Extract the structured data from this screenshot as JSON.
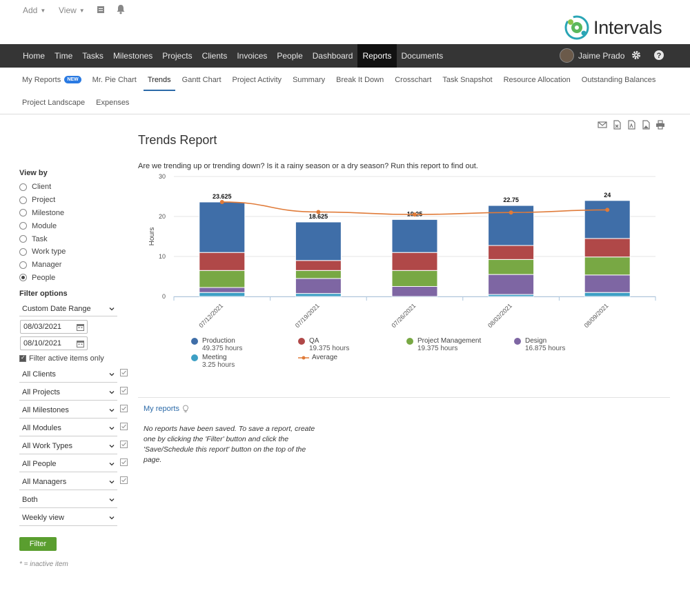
{
  "topbar": {
    "add_label": "Add",
    "view_label": "View",
    "logo_text": "Intervals"
  },
  "nav": {
    "items": [
      {
        "label": "Home"
      },
      {
        "label": "Time"
      },
      {
        "label": "Tasks"
      },
      {
        "label": "Milestones"
      },
      {
        "label": "Projects"
      },
      {
        "label": "Clients"
      },
      {
        "label": "Invoices"
      },
      {
        "label": "People"
      },
      {
        "label": "Dashboard"
      },
      {
        "label": "Reports",
        "active": true
      },
      {
        "label": "Documents"
      }
    ],
    "user_name": "Jaime Prado"
  },
  "subnav": {
    "row1": [
      {
        "label": "My Reports",
        "badge": "NEW"
      },
      {
        "label": "Mr. Pie Chart"
      },
      {
        "label": "Trends",
        "active": true
      },
      {
        "label": "Gantt Chart"
      },
      {
        "label": "Project Activity"
      },
      {
        "label": "Summary"
      },
      {
        "label": "Break It Down"
      },
      {
        "label": "Crosschart"
      },
      {
        "label": "Task Snapshot"
      },
      {
        "label": "Resource Allocation"
      },
      {
        "label": "Outstanding Balances"
      }
    ],
    "row2": [
      {
        "label": "Project Landscape"
      },
      {
        "label": "Expenses"
      }
    ]
  },
  "sidebar": {
    "view_by_title": "View by",
    "view_by": [
      {
        "label": "Client"
      },
      {
        "label": "Project"
      },
      {
        "label": "Milestone"
      },
      {
        "label": "Module"
      },
      {
        "label": "Task"
      },
      {
        "label": "Work type"
      },
      {
        "label": "Manager"
      },
      {
        "label": "People",
        "selected": true
      }
    ],
    "filter_title": "Filter options",
    "date_range": "Custom Date Range",
    "date_from": "08/03/2021",
    "date_to": "08/10/2021",
    "active_only_label": "Filter active items only",
    "filters": [
      "All Clients",
      "All Projects",
      "All Milestones",
      "All Modules",
      "All Work Types",
      "All People",
      "All Managers"
    ],
    "billable": "Both",
    "period": "Weekly view",
    "filter_button": "Filter",
    "inactive_note": "* = inactive item"
  },
  "main": {
    "title": "Trends Report",
    "description": "Are we trending up or trending down? Is it a rainy season or a dry season? Run this report to find out.",
    "my_reports_label": "My reports",
    "no_reports_text": "No reports have been saved. To save a report, create one by clicking the 'Filter' button and click the 'Save/Schedule this report' button on the top of the page."
  },
  "chart_data": {
    "type": "bar",
    "stacked": true,
    "ylabel": "Hours",
    "ylim": [
      0,
      30
    ],
    "yticks": [
      0,
      10,
      20,
      30
    ],
    "categories": [
      "07/12/2021",
      "07/19/2021",
      "07/26/2021",
      "08/02/2021",
      "08/09/2021"
    ],
    "totals": [
      "23.625",
      "18.625",
      "19.25",
      "22.75",
      "24"
    ],
    "series": [
      {
        "name": "Meeting",
        "color": "#3d9fc4",
        "values": [
          1.0,
          0.75,
          0,
          0.5,
          1.0
        ],
        "total_label": "3.25 hours"
      },
      {
        "name": "Design",
        "color": "#7e66a3",
        "values": [
          1.25,
          3.75,
          2.5,
          5.0,
          4.375
        ],
        "total_label": "16.875 hours"
      },
      {
        "name": "Project Management",
        "color": "#78a844",
        "values": [
          4.25,
          2.0,
          4.0,
          3.75,
          4.5
        ],
        "total_label": "19.375 hours"
      },
      {
        "name": "QA",
        "color": "#b04848",
        "values": [
          4.5,
          2.5,
          4.5,
          3.5,
          4.625
        ],
        "total_label": "19.375 hours"
      },
      {
        "name": "Production",
        "color": "#3f6ea8",
        "values": [
          12.625,
          9.625,
          8.25,
          10.0,
          9.5
        ],
        "total_label": "49.375 hours"
      }
    ],
    "average": {
      "name": "Average",
      "color": "#e07b39",
      "values": [
        23.625,
        21.125,
        20.5,
        21.0,
        21.65
      ]
    }
  }
}
